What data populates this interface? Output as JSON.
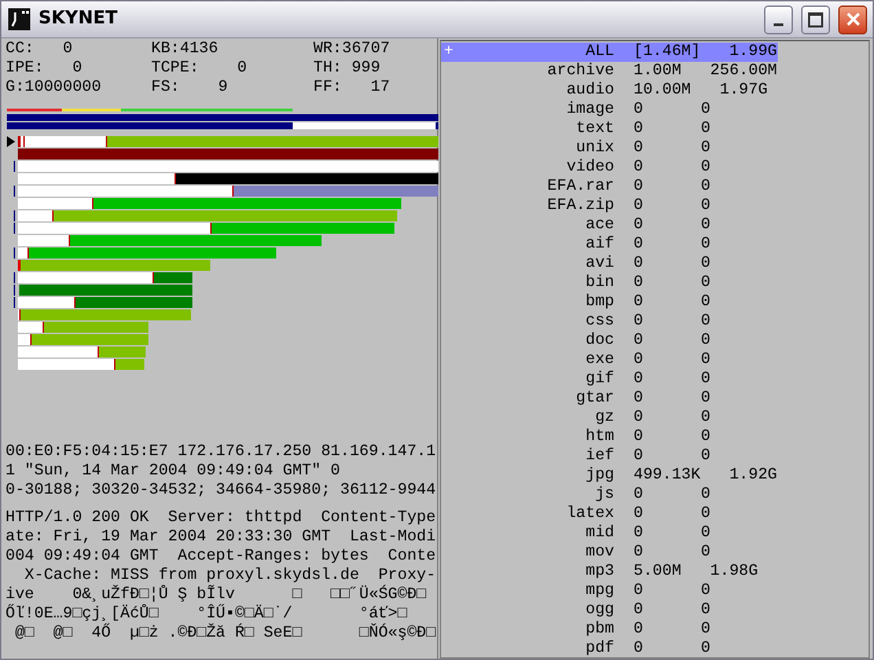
{
  "window": {
    "title": "SKYNET"
  },
  "stats": [
    {
      "text": "CC:   0"
    },
    {
      "text": "KB:4136"
    },
    {
      "text": "WR:36707"
    },
    {
      "text": "IPE:   0"
    },
    {
      "text": "TCPE:    0"
    },
    {
      "text": "TH: 999"
    },
    {
      "text": "G:10000000"
    },
    {
      "text": "FS:    9"
    },
    {
      "text": "FF:   17"
    }
  ],
  "log_blocks": [
    [
      "00:E0:F5:04:15:E7 172.176.17.250 81.169.147.1",
      "1 \"Sun, 14 Mar 2004 09:49:04 GMT\" 0",
      "0-30188; 30320-34532; 34664-35980; 36112-9944"
    ],
    [
      "HTTP/1.0 200 OK  Server: thttpd  Content-Type",
      "ate: Fri, 19 Mar 2004 20:33:30 GMT  Last-Modi",
      "004 09:49:04 GMT  Accept-Ranges: bytes  Conte",
      "  X-Cache: MISS from proxyl.skydsl.de  Proxy-",
      "ive    0&¸uŽfĐ□¦Ů Ş bĨlv      □   □□˝Ü«ŚG©Đ□",
      "Őľ!0E…9□çj¸[ÄćŮ□    °ÎŰ▪©□Ä□˙/       °áť>□",
      " @□  @□  4Ő  µ□ż .©Đ□Žă Ŕ□ SeE□      □ŇÓ«ş©Đ□"
    ]
  ],
  "file_types": [
    {
      "marker": "+",
      "name": "ALL",
      "size": "[1.46M]",
      "total": "1.99G",
      "selected": true
    },
    {
      "name": "archive",
      "size": "1.00M",
      "total": "256.00M",
      "selected": false
    },
    {
      "name": "audio",
      "size": "10.00M",
      "total": "1.97G",
      "selected": false
    },
    {
      "name": "image",
      "size": "0",
      "total": "0",
      "selected": false
    },
    {
      "name": "text",
      "size": "0",
      "total": "0",
      "selected": false
    },
    {
      "name": "unix",
      "size": "0",
      "total": "0",
      "selected": false
    },
    {
      "name": "video",
      "size": "0",
      "total": "0",
      "selected": false
    },
    {
      "name": "EFA.rar",
      "size": "0",
      "total": "0",
      "selected": false
    },
    {
      "name": "EFA.zip",
      "size": "0",
      "total": "0",
      "selected": false
    },
    {
      "name": "ace",
      "size": "0",
      "total": "0",
      "selected": false
    },
    {
      "name": "aif",
      "size": "0",
      "total": "0",
      "selected": false
    },
    {
      "name": "avi",
      "size": "0",
      "total": "0",
      "selected": false
    },
    {
      "name": "bin",
      "size": "0",
      "total": "0",
      "selected": false
    },
    {
      "name": "bmp",
      "size": "0",
      "total": "0",
      "selected": false
    },
    {
      "name": "css",
      "size": "0",
      "total": "0",
      "selected": false
    },
    {
      "name": "doc",
      "size": "0",
      "total": "0",
      "selected": false
    },
    {
      "name": "exe",
      "size": "0",
      "total": "0",
      "selected": false
    },
    {
      "name": "gif",
      "size": "0",
      "total": "0",
      "selected": false
    },
    {
      "name": "gtar",
      "size": "0",
      "total": "0",
      "selected": false
    },
    {
      "name": "gz",
      "size": "0",
      "total": "0",
      "selected": false
    },
    {
      "name": "htm",
      "size": "0",
      "total": "0",
      "selected": false
    },
    {
      "name": "ief",
      "size": "0",
      "total": "0",
      "selected": false
    },
    {
      "name": "jpg",
      "size": "499.13K",
      "total": "1.92G",
      "selected": false
    },
    {
      "name": "js",
      "size": "0",
      "total": "0",
      "selected": false
    },
    {
      "name": "latex",
      "size": "0",
      "total": "0",
      "selected": false
    },
    {
      "name": "mid",
      "size": "0",
      "total": "0",
      "selected": false
    },
    {
      "name": "mov",
      "size": "0",
      "total": "0",
      "selected": false
    },
    {
      "name": "mp3",
      "size": "5.00M",
      "total": "1.98G",
      "selected": false
    },
    {
      "name": "mpg",
      "size": "0",
      "total": "0",
      "selected": false
    },
    {
      "name": "ogg",
      "size": "0",
      "total": "0",
      "selected": false
    },
    {
      "name": "pbm",
      "size": "0",
      "total": "0",
      "selected": false
    },
    {
      "name": "pdf",
      "size": "0",
      "total": "0",
      "selected": false
    }
  ]
}
